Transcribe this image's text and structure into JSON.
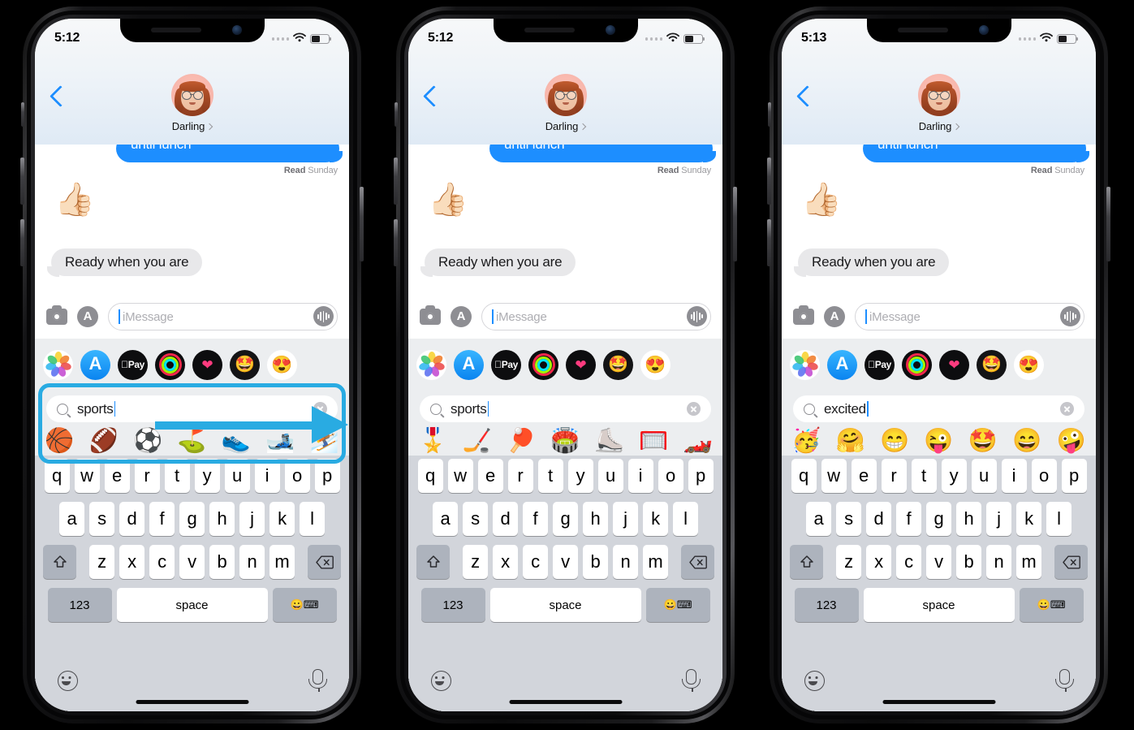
{
  "panels": [
    {
      "id": "panel-1",
      "status": {
        "time": "5:12",
        "signal_dots": 4,
        "wifi": "wifi-icon",
        "battery_level": "52%"
      },
      "nav": {
        "back": "back-chevron",
        "contact_name": "Darling",
        "avatar": "memoji-avatar"
      },
      "conversation": {
        "sent_message": "until lunch",
        "receipt_status": "Read",
        "receipt_day": "Sunday",
        "reaction_emoji": "👍🏻",
        "received_message": "Ready when you are"
      },
      "composer": {
        "camera": "camera-icon",
        "apps": "app-store-icon",
        "placeholder": "iMessage",
        "audio": "audio-wave-icon"
      },
      "app_drawer": [
        "photos-icon",
        "app-store-icon",
        "apple-pay-icon",
        "activity-rings-icon",
        "health-icon",
        "memoji-icon",
        "sticker-icon"
      ],
      "emoji_search": {
        "query": "sports",
        "clear": "clear-icon",
        "search": "search-icon",
        "results": [
          "🏀",
          "🏈",
          "⚽",
          "⛳",
          "👟",
          "🎿",
          "⛷️"
        ]
      },
      "annotation": {
        "type": "arrow-right",
        "color": "#29abe2",
        "highlight": true
      },
      "keyboard": {
        "row1": [
          "q",
          "w",
          "e",
          "r",
          "t",
          "y",
          "u",
          "i",
          "o",
          "p"
        ],
        "row2": [
          "a",
          "s",
          "d",
          "f",
          "g",
          "h",
          "j",
          "k",
          "l"
        ],
        "row3": [
          "z",
          "x",
          "c",
          "v",
          "b",
          "n",
          "m"
        ],
        "shift": "shift-icon",
        "delete": "delete-icon",
        "numeric": "123",
        "space": "space",
        "emoji_key": "😀⌨︎",
        "smiley": "smiley-icon",
        "mic": "microphone-icon"
      }
    },
    {
      "id": "panel-2",
      "status": {
        "time": "5:12",
        "signal_dots": 4,
        "wifi": "wifi-icon",
        "battery_level": "52%"
      },
      "nav": {
        "back": "back-chevron",
        "contact_name": "Darling",
        "avatar": "memoji-avatar"
      },
      "conversation": {
        "sent_message": "until lunch",
        "receipt_status": "Read",
        "receipt_day": "Sunday",
        "reaction_emoji": "👍🏻",
        "received_message": "Ready when you are"
      },
      "composer": {
        "camera": "camera-icon",
        "apps": "app-store-icon",
        "placeholder": "iMessage",
        "audio": "audio-wave-icon"
      },
      "app_drawer": [
        "photos-icon",
        "app-store-icon",
        "apple-pay-icon",
        "activity-rings-icon",
        "health-icon",
        "memoji-icon",
        "sticker-icon"
      ],
      "emoji_search": {
        "query": "sports",
        "clear": "clear-icon",
        "search": "search-icon",
        "results": [
          "🎖️",
          "🏒",
          "🏓",
          "🏟️",
          "⛸️",
          "🥅",
          "🏎️"
        ]
      },
      "annotation": {
        "type": "none",
        "color": "",
        "highlight": false
      },
      "keyboard": {
        "row1": [
          "q",
          "w",
          "e",
          "r",
          "t",
          "y",
          "u",
          "i",
          "o",
          "p"
        ],
        "row2": [
          "a",
          "s",
          "d",
          "f",
          "g",
          "h",
          "j",
          "k",
          "l"
        ],
        "row3": [
          "z",
          "x",
          "c",
          "v",
          "b",
          "n",
          "m"
        ],
        "shift": "shift-icon",
        "delete": "delete-icon",
        "numeric": "123",
        "space": "space",
        "emoji_key": "😀⌨︎",
        "smiley": "smiley-icon",
        "mic": "microphone-icon"
      }
    },
    {
      "id": "panel-3",
      "status": {
        "time": "5:13",
        "signal_dots": 4,
        "wifi": "wifi-icon",
        "battery_level": "52%"
      },
      "nav": {
        "back": "back-chevron",
        "contact_name": "Darling",
        "avatar": "memoji-avatar"
      },
      "conversation": {
        "sent_message": "until lunch",
        "receipt_status": "Read",
        "receipt_day": "Sunday",
        "reaction_emoji": "👍🏻",
        "received_message": "Ready when you are"
      },
      "composer": {
        "camera": "camera-icon",
        "apps": "app-store-icon",
        "placeholder": "iMessage",
        "audio": "audio-wave-icon"
      },
      "app_drawer": [
        "photos-icon",
        "app-store-icon",
        "apple-pay-icon",
        "activity-rings-icon",
        "health-icon",
        "memoji-icon",
        "sticker-icon"
      ],
      "emoji_search": {
        "query": "excited",
        "clear": "clear-icon",
        "search": "search-icon",
        "results": [
          "🥳",
          "🤗",
          "😁",
          "😜",
          "🤩",
          "😄",
          "🤪"
        ]
      },
      "annotation": {
        "type": "none",
        "color": "",
        "highlight": false
      },
      "keyboard": {
        "row1": [
          "q",
          "w",
          "e",
          "r",
          "t",
          "y",
          "u",
          "i",
          "o",
          "p"
        ],
        "row2": [
          "a",
          "s",
          "d",
          "f",
          "g",
          "h",
          "j",
          "k",
          "l"
        ],
        "row3": [
          "z",
          "x",
          "c",
          "v",
          "b",
          "n",
          "m"
        ],
        "shift": "shift-icon",
        "delete": "delete-icon",
        "numeric": "123",
        "space": "space",
        "emoji_key": "😀⌨︎",
        "smiley": "smiley-icon",
        "mic": "microphone-icon"
      }
    }
  ],
  "colors": {
    "accent": "#1d8eff",
    "annotation": "#29abe2",
    "bubble_received": "#e8e8ea",
    "keyboard_bg": "#d2d5db"
  }
}
